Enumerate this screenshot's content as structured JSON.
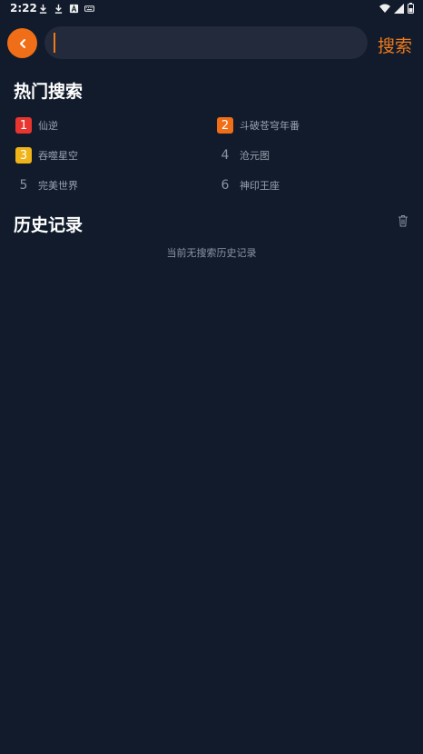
{
  "status_bar": {
    "time": "2:22",
    "left_icons": [
      "download-icon",
      "download-icon",
      "a-icon",
      "keyboard-icon"
    ],
    "right_icons": [
      "wifi-icon",
      "signal-icon",
      "battery-icon"
    ]
  },
  "search": {
    "placeholder": "",
    "value": "",
    "submit_label": "搜索",
    "back_icon": "chevron-left-icon"
  },
  "hot_search": {
    "title": "热门搜索",
    "items": [
      {
        "rank": "1",
        "label": "仙逆",
        "color": "#e8352f"
      },
      {
        "rank": "2",
        "label": "斗破苍穹年番",
        "color": "#f06e17"
      },
      {
        "rank": "3",
        "label": "吞噬星空",
        "color": "#f0b318"
      },
      {
        "rank": "4",
        "label": "沧元图",
        "color": ""
      },
      {
        "rank": "5",
        "label": "完美世界",
        "color": ""
      },
      {
        "rank": "6",
        "label": "神印王座",
        "color": ""
      }
    ]
  },
  "history": {
    "title": "历史记录",
    "empty_text": "当前无搜索历史记录",
    "clear_icon": "trash-icon"
  },
  "colors": {
    "background": "#111b2b",
    "accent": "#f06e17",
    "search_box": "#222a3c"
  }
}
